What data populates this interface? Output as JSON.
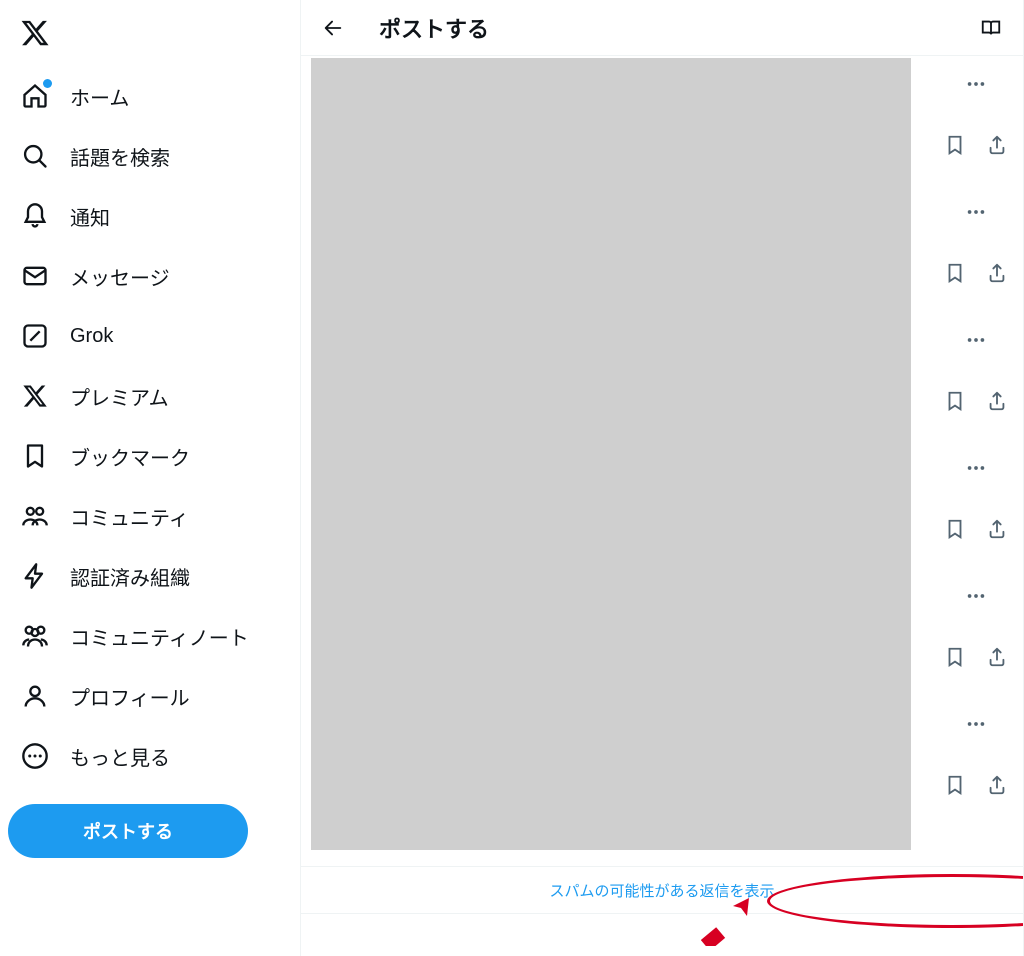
{
  "sidebar": {
    "items": [
      {
        "id": "home",
        "label": "ホーム",
        "icon": "home-icon",
        "notify": true
      },
      {
        "id": "explore",
        "label": "話題を検索",
        "icon": "search-icon",
        "notify": false
      },
      {
        "id": "notifications",
        "label": "通知",
        "icon": "bell-icon",
        "notify": false
      },
      {
        "id": "messages",
        "label": "メッセージ",
        "icon": "mail-icon",
        "notify": false
      },
      {
        "id": "grok",
        "label": "Grok",
        "icon": "grok-icon",
        "notify": false
      },
      {
        "id": "premium",
        "label": "プレミアム",
        "icon": "x-icon",
        "notify": false
      },
      {
        "id": "bookmarks",
        "label": "ブックマーク",
        "icon": "bookmark-icon",
        "notify": false
      },
      {
        "id": "communities",
        "label": "コミュニティ",
        "icon": "communities-icon",
        "notify": false
      },
      {
        "id": "verified-orgs",
        "label": "認証済み組織",
        "icon": "lightning-icon",
        "notify": false
      },
      {
        "id": "community-notes",
        "label": "コミュニティノート",
        "icon": "community-notes-icon",
        "notify": false
      },
      {
        "id": "profile",
        "label": "プロフィール",
        "icon": "person-icon",
        "notify": false
      },
      {
        "id": "more",
        "label": "もっと見る",
        "icon": "more-circle-icon",
        "notify": false
      }
    ],
    "post_button_label": "ポストする"
  },
  "header": {
    "title": "ポストする"
  },
  "spam_banner": {
    "label": "スパムの可能性がある返信を表示"
  },
  "colors": {
    "accent": "#1d9bf0",
    "annotation": "#d70022"
  }
}
